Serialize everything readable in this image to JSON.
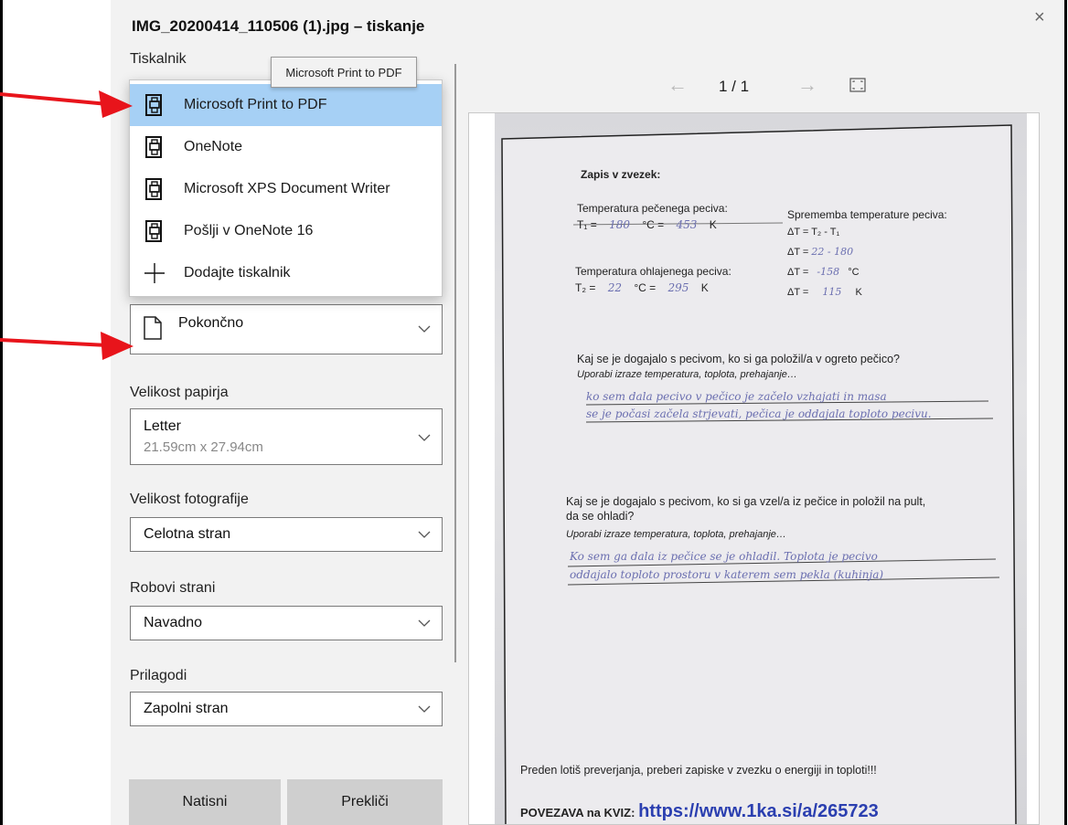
{
  "dialog": {
    "title": "IMG_20200414_110506 (1).jpg – tiskanje",
    "close_glyph": "×"
  },
  "printer": {
    "label": "Tiskalnik",
    "tooltip": "Microsoft Print to PDF",
    "options": [
      {
        "label": "Microsoft Print to PDF",
        "icon": "printer-icon",
        "selected": true
      },
      {
        "label": "OneNote",
        "icon": "printer-icon",
        "selected": false
      },
      {
        "label": "Microsoft XPS Document Writer",
        "icon": "printer-icon",
        "selected": false
      },
      {
        "label": "Pošlji v OneNote 16",
        "icon": "printer-icon",
        "selected": false
      },
      {
        "label": "Dodajte tiskalnik",
        "icon": "plus-icon",
        "selected": false
      }
    ]
  },
  "orientation": {
    "value": "Pokončno",
    "icon": "page-icon"
  },
  "paper_size": {
    "label": "Velikost papirja",
    "value": "Letter",
    "sub": "21.59cm x 27.94cm"
  },
  "photo_size": {
    "label": "Velikost fotografije",
    "value": "Celotna stran"
  },
  "margins": {
    "label": "Robovi strani",
    "value": "Navadno"
  },
  "fit": {
    "label": "Prilagodi",
    "value": "Zapolni stran"
  },
  "buttons": {
    "print": "Natisni",
    "cancel": "Prekliči"
  },
  "pager": {
    "text": "1 / 1",
    "prev_glyph": "←",
    "next_glyph": "→"
  },
  "document": {
    "heading": "Zapis v zvezek:",
    "t1_label": "Temperatura pečenega peciva:",
    "t1_line": "T₁ =",
    "t1_c": "180",
    "t1_unit_c": "°C =",
    "t1_k": "453",
    "unit_k": "K",
    "t2_label": "Temperatura ohlajenega peciva:",
    "t2_line": "T₂ =",
    "t2_c": "22",
    "t2_k": "295",
    "change_label": "Sprememba temperature peciva:",
    "dt_formula": "ΔT = T₂ - T₁",
    "dt_line1_prefix": "ΔT =",
    "dt_line1_hw": "22 - 180",
    "dt_line2_hw": "-158",
    "dt_unit_c": "°C",
    "dt_line3_hw": "115",
    "q1": "Kaj se je dogajalo s pecivom, ko si ga položil/a v ogreto pečico?",
    "q1_hint": "Uporabi izraze temperatura, toplota, prehajanje…",
    "a1_l1": "ko sem dala pecivo v pečico je začelo vzhajati in masa",
    "a1_l2": "se je počasi začela strjevati, pečica je oddajala toploto pecivu.",
    "q2_l1": "Kaj se je dogajalo s pecivom, ko si ga vzel/a iz pečice in položil na pult,",
    "q2_l2": "da se ohladi?",
    "q2_hint": "Uporabi izraze temperatura, toplota, prehajanje…",
    "a2_l1": "Ko sem ga dala iz pečice se je ohladil. Toplota je pecivo",
    "a2_l2": "oddajalo toploto prostoru v katerem sem pekla (kuhinja)",
    "footer1": "Preden lotiš preverjanja, preberi zapiske v zvezku o energiji in toploti!!!",
    "footer2_prefix": "POVEZAVA na KVIZ:",
    "footer2_link": "https://www.1ka.si/a/265723"
  },
  "colors": {
    "accent": "#a6d0f5",
    "annotation_arrow": "#e8141b"
  }
}
